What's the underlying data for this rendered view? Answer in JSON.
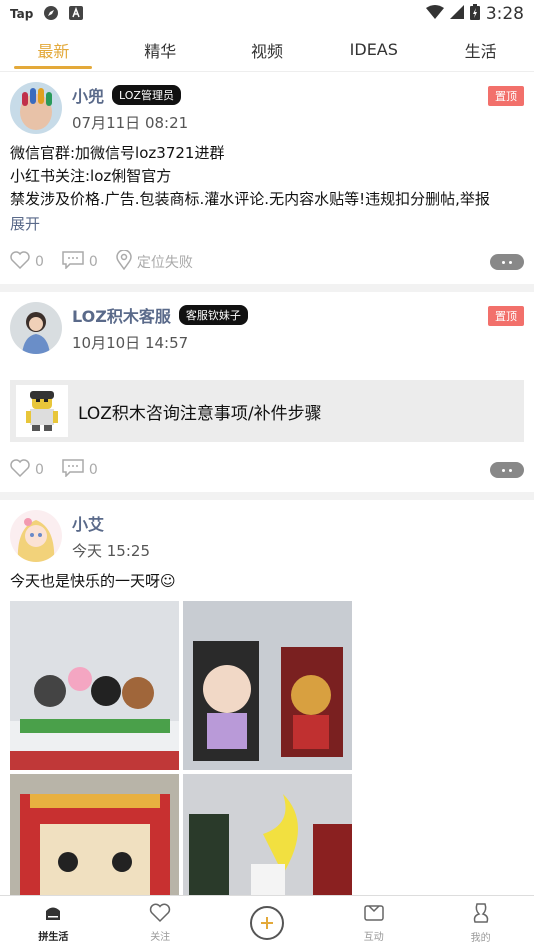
{
  "status_bar": {
    "app_label": "Tap",
    "time": "3:28"
  },
  "tabs": [
    {
      "label": "最新",
      "active": true
    },
    {
      "label": "精华"
    },
    {
      "label": "视频"
    },
    {
      "label": "IDEAS"
    },
    {
      "label": "生活"
    }
  ],
  "posts": [
    {
      "author": "小兜",
      "badge": "LOZ管理员",
      "pin_label": "置顶",
      "time": "07月11日 08:21",
      "lines": [
        "微信官群:加微信号loz3721进群",
        "小红书关注:loz俐智官方",
        "禁发涉及价格.广告.包装商标.灌水评论.无内容水贴等!违规扣分删帖,举报"
      ],
      "expand_label": "展开",
      "likes": "0",
      "comments": "0",
      "location": "定位失败"
    },
    {
      "author": "LOZ积木客服",
      "badge": "客服钦妹子",
      "pin_label": "置顶",
      "time": "10月10日 14:57",
      "link_title": "LOZ积木咨询注意事项/补件步骤",
      "likes": "0",
      "comments": "0"
    },
    {
      "author": "小艾",
      "time": "今天 15:25",
      "text": "今天也是快乐的一天呀☺"
    }
  ],
  "bottom_nav": [
    {
      "label": "拼生活",
      "icon": "home-icon",
      "active": true
    },
    {
      "label": "关注",
      "icon": "heart-icon"
    },
    {
      "label": "",
      "icon": "add-icon"
    },
    {
      "label": "互动",
      "icon": "message-box-icon"
    },
    {
      "label": "我的",
      "icon": "profile-icon"
    }
  ],
  "colors": {
    "accent": "#e3a93a",
    "pin": "#f2706b",
    "name": "#5a6a8a"
  }
}
